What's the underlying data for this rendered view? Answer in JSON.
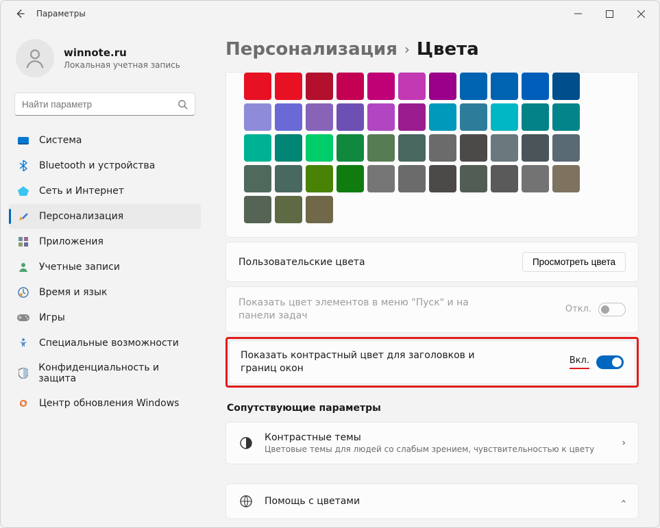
{
  "window": {
    "title": "Параметры"
  },
  "user": {
    "name": "winnote.ru",
    "subtitle": "Локальная учетная запись"
  },
  "search": {
    "placeholder": "Найти параметр"
  },
  "nav": {
    "items": [
      {
        "label": "Система",
        "icon": "💻",
        "id": "system"
      },
      {
        "label": "Bluetooth и устройства",
        "icon": "bt",
        "id": "bluetooth"
      },
      {
        "label": "Сеть и Интернет",
        "icon": "💎",
        "id": "network"
      },
      {
        "label": "Персонализация",
        "icon": "🖌",
        "id": "personalization",
        "selected": true
      },
      {
        "label": "Приложения",
        "icon": "▦",
        "id": "apps"
      },
      {
        "label": "Учетные записи",
        "icon": "👤",
        "id": "accounts"
      },
      {
        "label": "Время и язык",
        "icon": "🌐",
        "id": "time"
      },
      {
        "label": "Игры",
        "icon": "🎮",
        "id": "gaming"
      },
      {
        "label": "Специальные возможности",
        "icon": "♿",
        "id": "accessibility"
      },
      {
        "label": "Конфиденциальность и защита",
        "icon": "🛡",
        "id": "privacy"
      },
      {
        "label": "Центр обновления Windows",
        "icon": "🔄",
        "id": "update"
      }
    ]
  },
  "breadcrumb": {
    "parent": "Персонализация",
    "current": "Цвета"
  },
  "colors": {
    "palette_partial": "Partial accent color grid (bottom rows visible)",
    "swatches": [
      [
        "#E81123",
        "#E81123",
        "#B3102E",
        "#C30052",
        "#BF0077",
        "#C239B3",
        "#9A0089",
        "#0063B1",
        "#0063B1",
        "#005EBB",
        "#004E8C"
      ],
      [
        "#8E8CD8",
        "#6B69D6",
        "#8764B8",
        "#6E4FB4",
        "#B146C2",
        "#9A1C8E",
        "#0099BC",
        "#2D7D9A",
        "#00B7C3",
        "#038387",
        "#03838A"
      ],
      [
        "#00B294",
        "#018574",
        "#00CC6A",
        "#10893E",
        "#567C53",
        "#486860",
        "#6B6B6B",
        "#4C4A48",
        "#69797E",
        "#4A5459",
        "#5A6A73"
      ],
      [
        "#4F6A5D",
        "#486860",
        "#498205",
        "#107C10",
        "#767676",
        "#6B6B6B",
        "#4C4A48",
        "#525E54",
        "#5A5A5A",
        "#737373",
        "#7E735F"
      ],
      [
        "#556455",
        "#5E6A43",
        "#71684A"
      ]
    ],
    "custom_label": "Пользовательские цвета",
    "custom_button": "Просмотреть цвета"
  },
  "settings": {
    "start_color": {
      "label": "Показать цвет элементов в меню \"Пуск\" и на панели задач",
      "state": "Откл.",
      "on": false,
      "disabled": true
    },
    "title_color": {
      "label": "Показать контрастный цвет для заголовков и границ окон",
      "state": "Вкл.",
      "on": true
    }
  },
  "related": {
    "heading": "Сопутствующие параметры",
    "contrast": {
      "title": "Контрастные темы",
      "subtitle": "Цветовые темы для людей со слабым зрением, чувствительностью к цвету"
    },
    "help": {
      "title": "Помощь с цветами"
    }
  }
}
